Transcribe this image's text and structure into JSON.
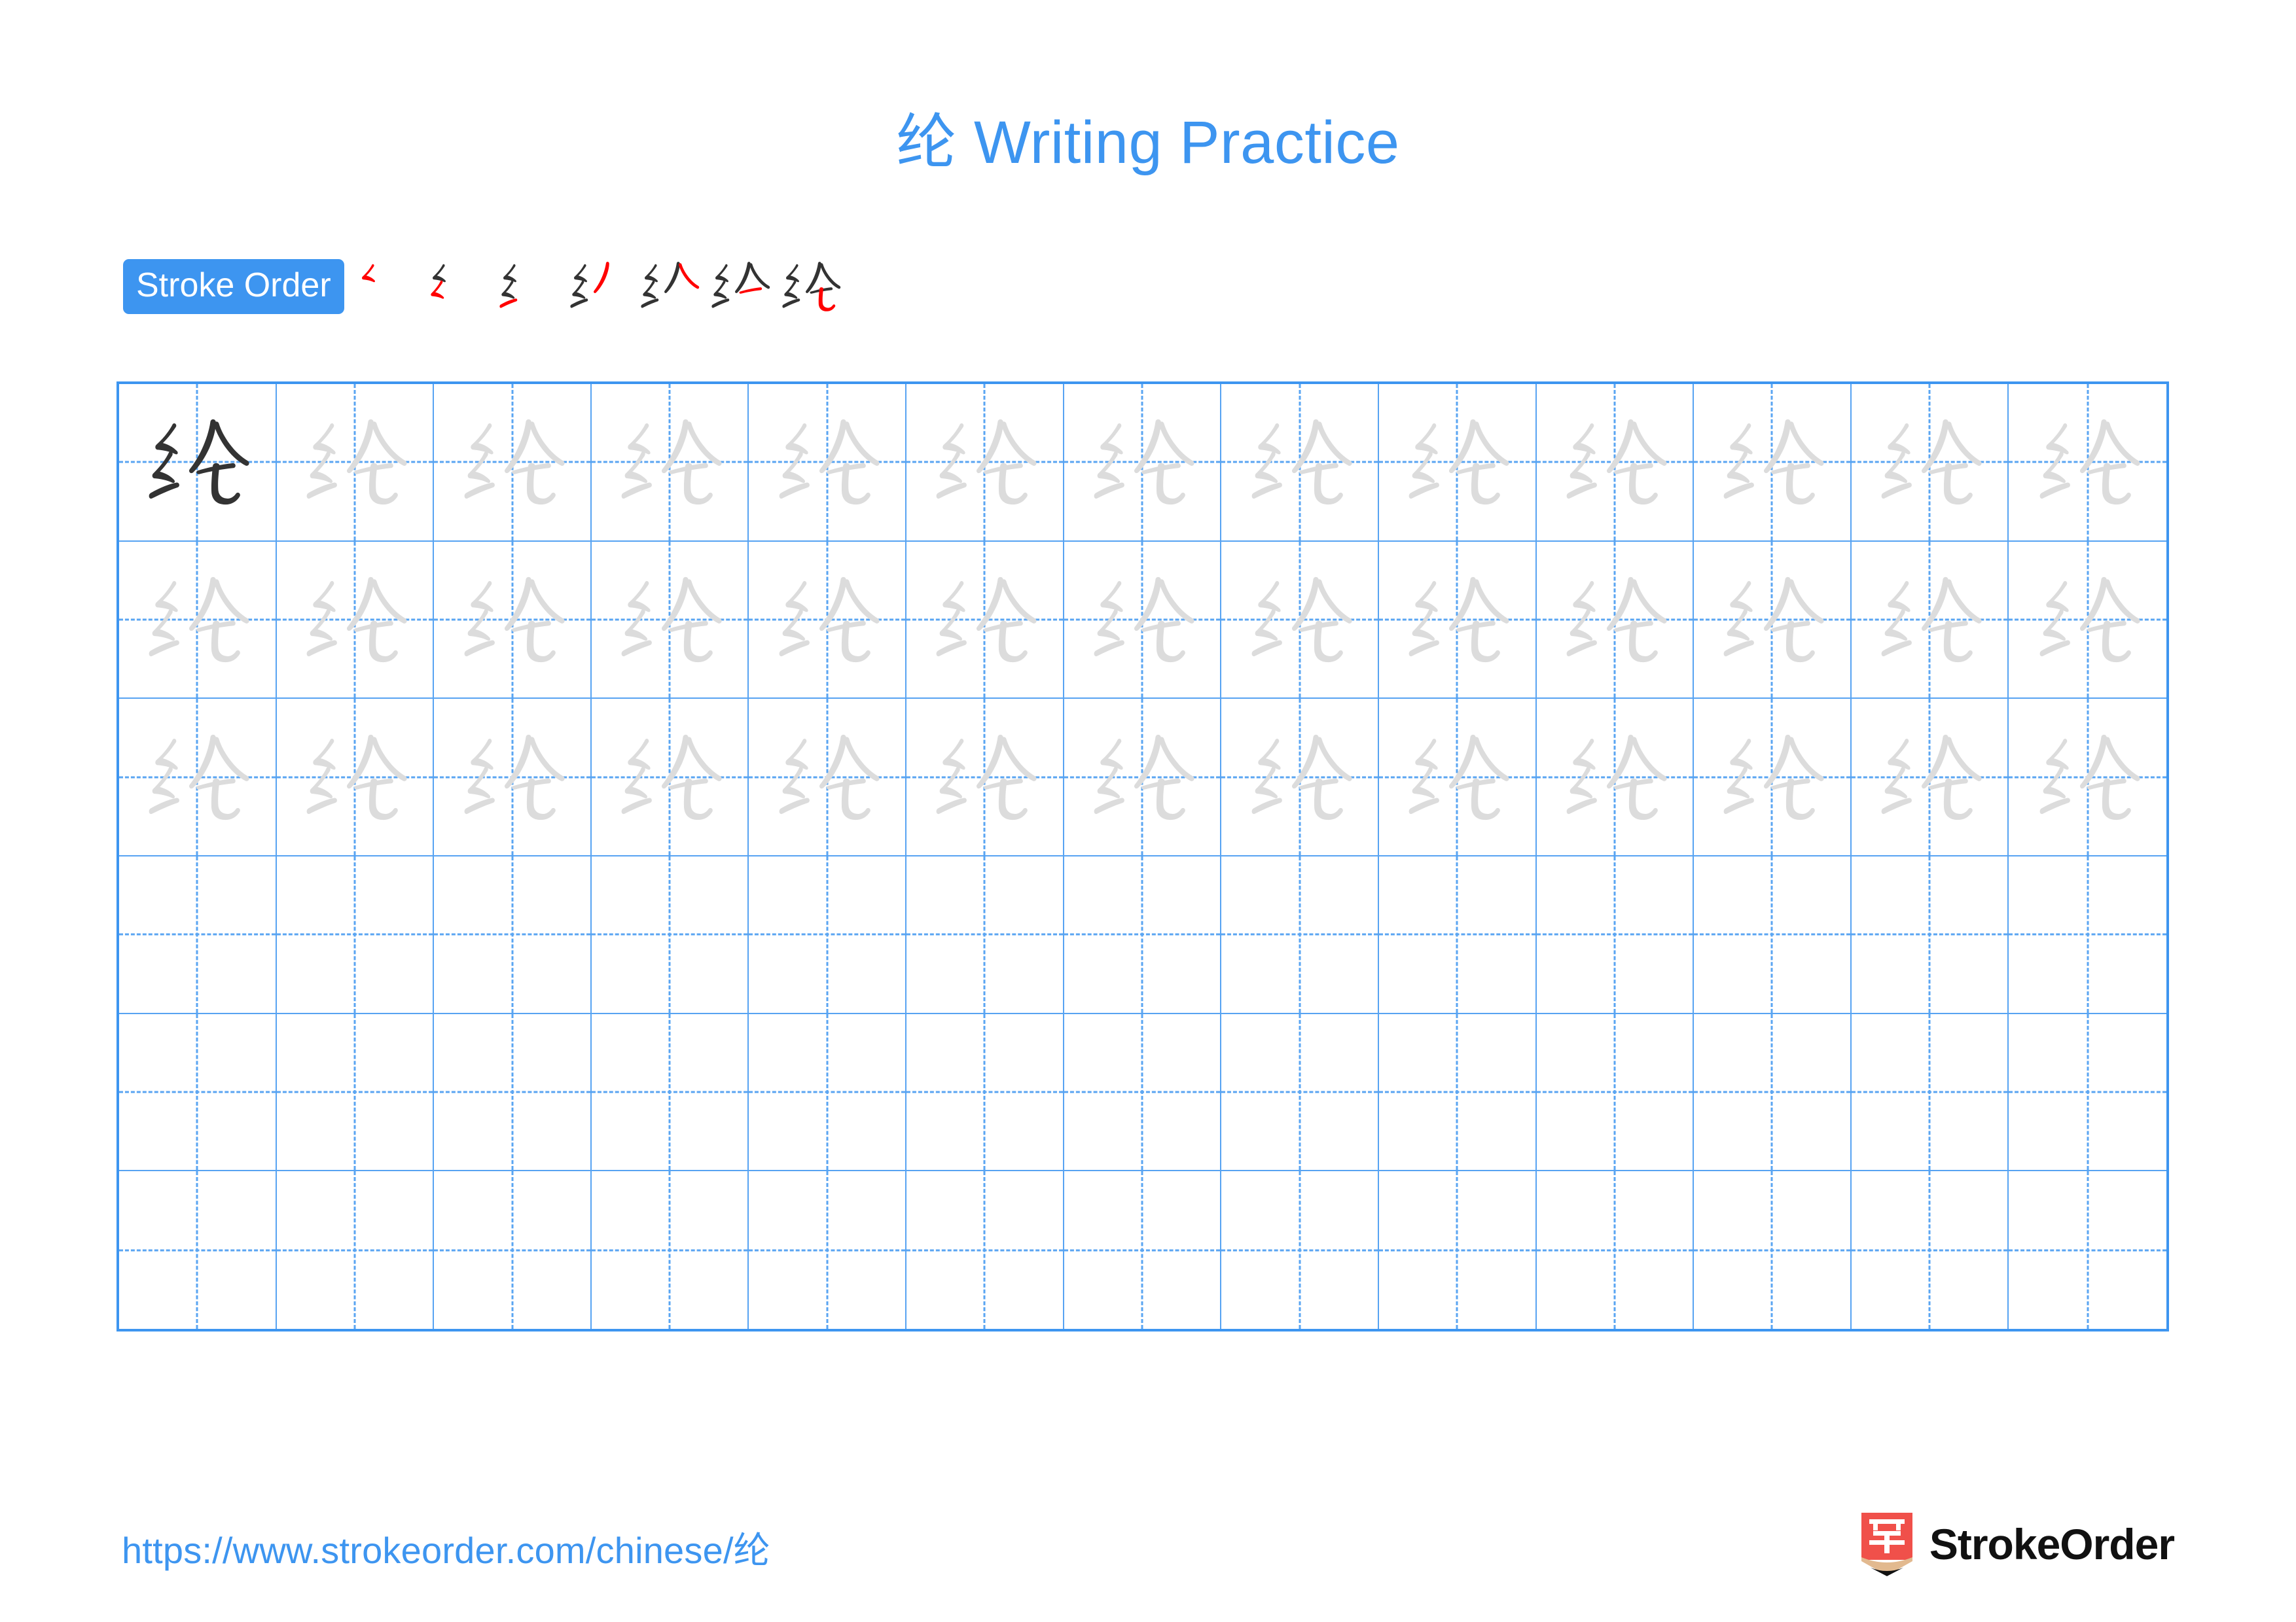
{
  "page": {
    "character": "纶",
    "background_color": "#ffffff"
  },
  "header": {
    "title_character": "纶",
    "title_text": " Writing Practice",
    "title_full": "纶 Writing Practice",
    "title_color": "#3d95f0"
  },
  "stroke_order": {
    "badge_label": "Stroke Order",
    "badge_bg_color": "#3d95f0",
    "badge_text_color": "#ffffff",
    "new_stroke_color": "#ff0000",
    "prior_stroke_color": "#333333",
    "step_count": 7,
    "steps": [
      {
        "index": 1,
        "strokes_shown": 1,
        "new_stroke": 1,
        "glyph": "乚"
      },
      {
        "index": 2,
        "strokes_shown": 2,
        "new_stroke": 2,
        "glyph": "纟"
      },
      {
        "index": 3,
        "strokes_shown": 3,
        "new_stroke": 3,
        "glyph": "纟"
      },
      {
        "index": 4,
        "strokes_shown": 4,
        "new_stroke": 4,
        "glyph": "纟"
      },
      {
        "index": 5,
        "strokes_shown": 5,
        "new_stroke": 5,
        "glyph": "纶"
      },
      {
        "index": 6,
        "strokes_shown": 6,
        "new_stroke": 6,
        "glyph": "纶"
      },
      {
        "index": 7,
        "strokes_shown": 7,
        "new_stroke": 7,
        "glyph": "纶"
      }
    ]
  },
  "practice_grid": {
    "columns": 13,
    "rows": 6,
    "grid_border_color": "#3d95f0",
    "cell_line_color": "#57a3f2",
    "guide_line_color": "#5aa5f2",
    "dark_char_color": "#333333",
    "traced_char_color": "#dcdcdc",
    "character": "纶",
    "row_fill": [
      {
        "row": 1,
        "filled": true,
        "first_cell_dark": true
      },
      {
        "row": 2,
        "filled": true,
        "first_cell_dark": false
      },
      {
        "row": 3,
        "filled": true,
        "first_cell_dark": false
      },
      {
        "row": 4,
        "filled": false,
        "first_cell_dark": false
      },
      {
        "row": 5,
        "filled": false,
        "first_cell_dark": false
      },
      {
        "row": 6,
        "filled": false,
        "first_cell_dark": false
      }
    ]
  },
  "footer": {
    "url": "https://www.strokeorder.com/chinese/纶",
    "url_color": "#3d95f0",
    "brand_name": "StrokeOrder",
    "brand_mark_character": "字",
    "brand_mark_color": "#f0504a",
    "brand_mark_tip_color": "#e2b98f"
  }
}
